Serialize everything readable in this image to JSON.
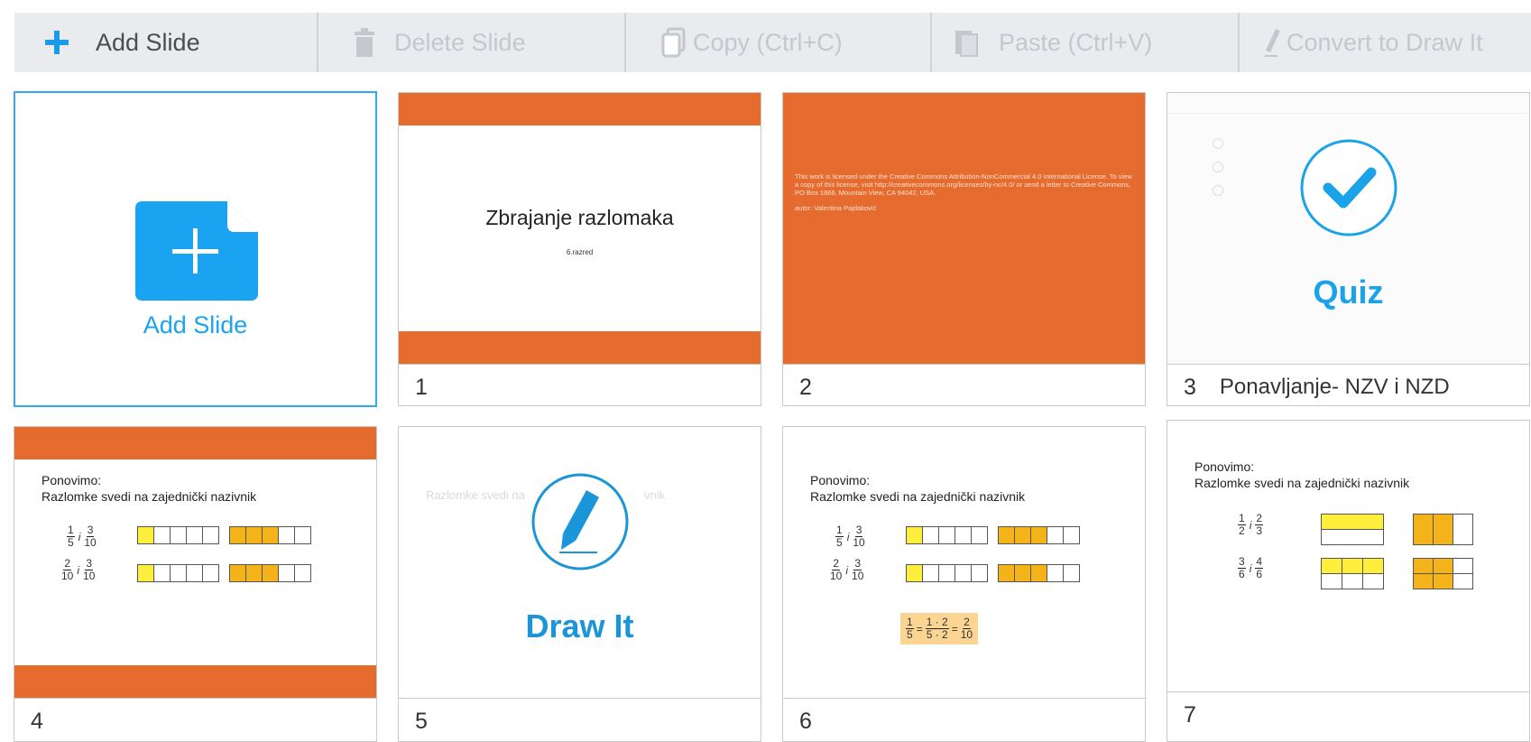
{
  "toolbar": {
    "add_slide": "Add Slide",
    "delete_slide": "Delete Slide",
    "copy": "Copy (Ctrl+C)",
    "paste": "Paste (Ctrl+V)",
    "convert": "Convert to Draw It"
  },
  "add_card": {
    "label": "Add Slide"
  },
  "slides": [
    {
      "number": "1",
      "caption_title": "",
      "title": "Zbrajanje razlomaka",
      "subtitle": "6.razred"
    },
    {
      "number": "2",
      "caption_title": "",
      "license_text": "This work is licensed under the Creative Commons Attribution-NonCommercial 4.0 International License. To view a copy of this license, visit http://creativecommons.org/licenses/by-nc/4.0/ or send a letter to Creative Commons, PO Box 1866, Mountain View, CA 94042, USA.",
      "author": "autor: Valentina Pajdaković"
    },
    {
      "number": "3",
      "caption_title": "Ponavljanje- NZV i NZD",
      "overlay_label": "Quiz"
    },
    {
      "number": "4",
      "caption_title": "",
      "heading1": "Ponovimo:",
      "heading2": "Razlomke svedi na zajednički nazivnik",
      "rows": [
        {
          "a_n": "1",
          "a_d": "5",
          "b_n": "3",
          "b_d": "10"
        },
        {
          "a_n": "2",
          "a_d": "10",
          "b_n": "3",
          "b_d": "10"
        }
      ]
    },
    {
      "number": "5",
      "caption_title": "",
      "overlay_label": "Draw It",
      "faded_text_left": "Razlomke svedi na",
      "faded_text_right": "vnik"
    },
    {
      "number": "6",
      "caption_title": "",
      "heading1": "Ponovimo:",
      "heading2": "Razlomke svedi na zajednički nazivnik",
      "rows": [
        {
          "a_n": "1",
          "a_d": "5",
          "b_n": "3",
          "b_d": "10"
        },
        {
          "a_n": "2",
          "a_d": "10",
          "b_n": "3",
          "b_d": "10"
        }
      ],
      "formula": {
        "l_n": "1",
        "l_d": "5",
        "m_n": "1 · 2",
        "m_d": "5 · 2",
        "r_n": "2",
        "r_d": "10"
      }
    },
    {
      "number": "7",
      "caption_title": "",
      "heading1": "Ponovimo:",
      "heading2": "Razlomke svedi na zajednički nazivnik",
      "rows": [
        {
          "a_n": "1",
          "a_d": "2",
          "b_n": "2",
          "b_d": "3"
        },
        {
          "a_n": "3",
          "a_d": "6",
          "b_n": "4",
          "b_d": "6"
        }
      ]
    }
  ],
  "colors": {
    "accent": "#1aa3f0",
    "slide_orange": "#e56b2f",
    "fill_yellow": "#ffef3c",
    "fill_orange": "#f5b31a"
  },
  "icons": {
    "add": "plus-icon",
    "delete": "trash-icon",
    "copy": "copy-icon",
    "paste": "paste-icon",
    "convert": "pencil-icon"
  }
}
